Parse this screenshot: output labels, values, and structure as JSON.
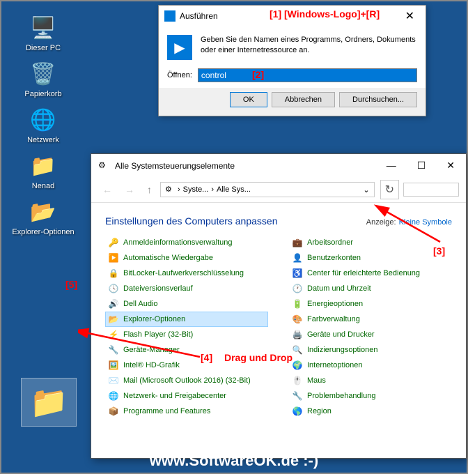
{
  "desktop": {
    "icons": [
      {
        "name": "dieser-pc",
        "label": "Dieser PC",
        "emoji": "🖥️"
      },
      {
        "name": "papierkorb",
        "label": "Papierkorb",
        "emoji": "🗑️"
      },
      {
        "name": "netzwerk",
        "label": "Netzwerk",
        "emoji": "🖧"
      },
      {
        "name": "nenad",
        "label": "Nenad",
        "emoji": "📁"
      },
      {
        "name": "explorer-optionen",
        "label": "Explorer-Optionen",
        "emoji": "📂"
      }
    ]
  },
  "run_dialog": {
    "title": "Ausführen",
    "description": "Geben Sie den Namen eines Programms, Ordners, Dokuments oder einer Internetressource an.",
    "open_label": "Öffnen:",
    "input_value": "control",
    "btn_ok": "OK",
    "btn_cancel": "Abbrechen",
    "btn_browse": "Durchsuchen..."
  },
  "control_panel": {
    "title": "Alle Systemsteuerungselemente",
    "breadcrumb": [
      "Syste...",
      "Alle Sys..."
    ],
    "heading": "Einstellungen des Computers anpassen",
    "view_label": "Anzeige:",
    "view_value": "Kleine Symbole",
    "items_left": [
      "Anmeldeinformationsverwaltung",
      "Automatische Wiedergabe",
      "BitLocker-Laufwerkverschlüsselung",
      "Dateiversionsverlauf",
      "Dell Audio",
      "Explorer-Optionen",
      "Flash Player (32-Bit)",
      "Geräte-Manager",
      "Intel® HD-Grafik",
      "Mail (Microsoft Outlook 2016) (32-Bit)",
      "Netzwerk- und Freigabecenter",
      "Programme und Features"
    ],
    "items_right": [
      "Arbeitsordner",
      "Benutzerkonten",
      "Center für erleichterte Bedienung",
      "Datum und Uhrzeit",
      "Energieoptionen",
      "Farbverwaltung",
      "Geräte und Drucker",
      "Indizierungsoptionen",
      "Internetoptionen",
      "Maus",
      "Problembehandlung",
      "Region"
    ],
    "selected_index": 5
  },
  "annotations": {
    "a1": "[1]  [Windows-Logo]+[R]",
    "a2": "[2]",
    "a3": "[3]",
    "a4": "[4]",
    "a5": "[5]",
    "drag": "Drag und Drop"
  },
  "watermark": "www.SoftwareOK.de :-)"
}
